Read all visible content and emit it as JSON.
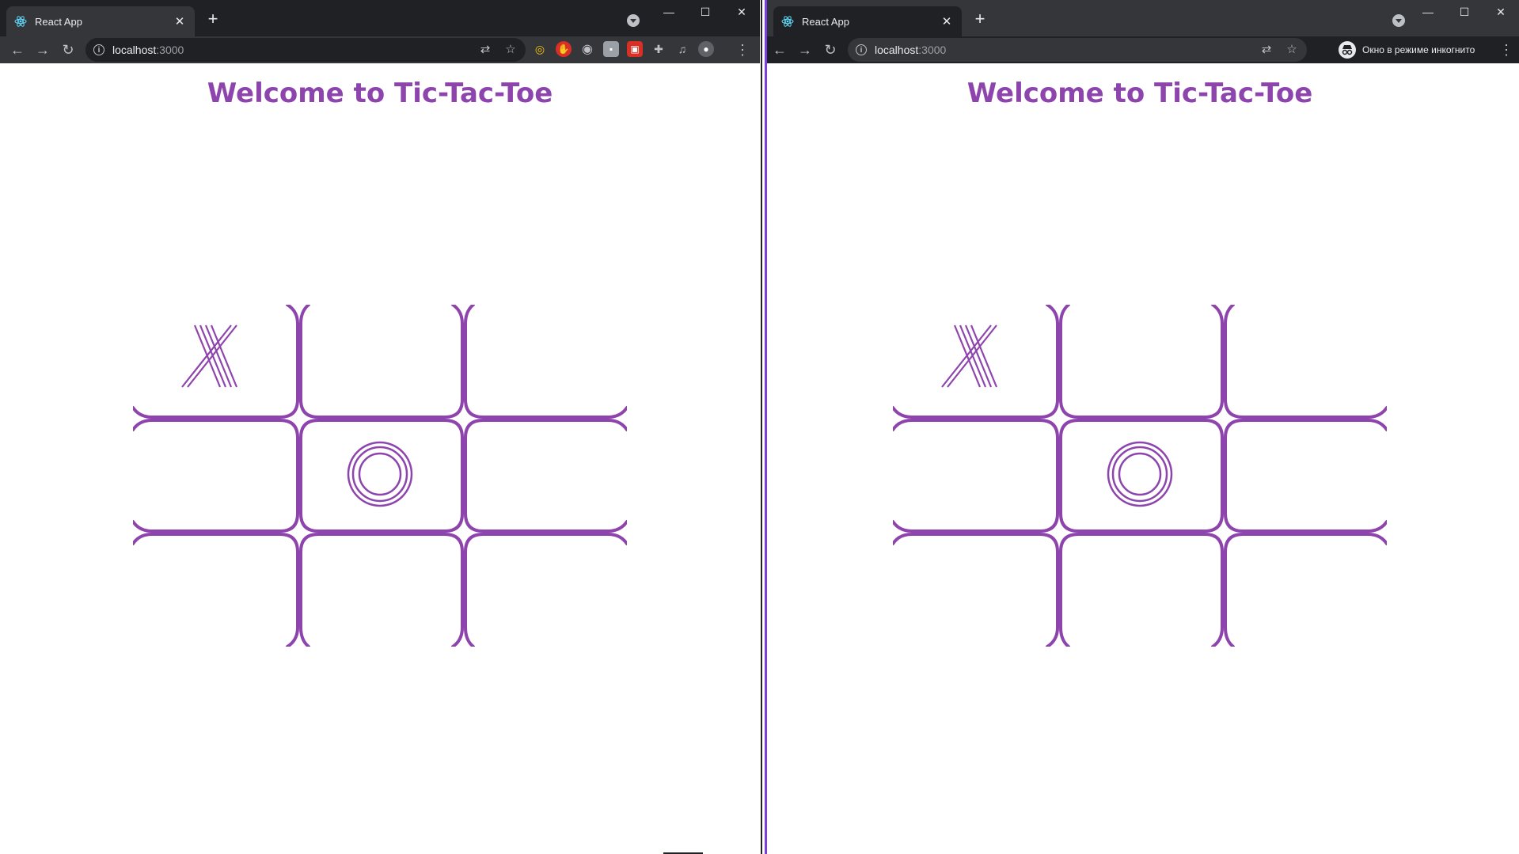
{
  "browser_left": {
    "tab_title": "React App",
    "url_host": "localhost",
    "url_port": ":3000"
  },
  "browser_right": {
    "tab_title": "React App",
    "url_host": "localhost",
    "url_port": ":3000",
    "incognito_label": "Окно в режиме инкогнито"
  },
  "game": {
    "title": "Welcome to Tic-Tac-Toe",
    "accent_color": "#8e44ad",
    "board_left": [
      "X",
      "",
      "",
      "",
      "O",
      "",
      "",
      "",
      ""
    ],
    "board_right": [
      "X",
      "",
      "",
      "",
      "O",
      "",
      "",
      "",
      ""
    ]
  }
}
